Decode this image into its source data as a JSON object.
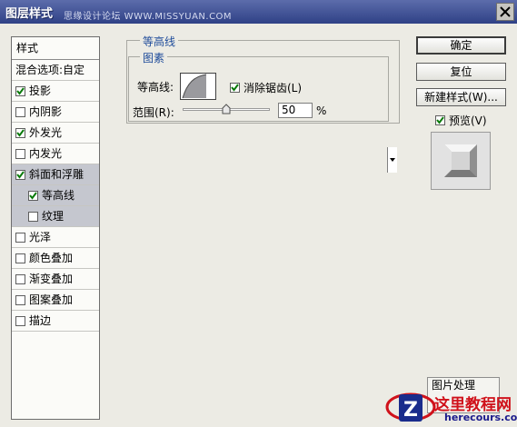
{
  "window": {
    "title": "图层样式",
    "watermark": "思缘设计论坛  WWW.MISSYUAN.COM",
    "close_glyph": "✕"
  },
  "style_list": {
    "header": "样式",
    "items": [
      {
        "label": "混合选项:自定",
        "checkbox": false,
        "checked": false,
        "indent": false,
        "selected": false
      },
      {
        "label": "投影",
        "checkbox": true,
        "checked": true,
        "indent": false,
        "selected": false
      },
      {
        "label": "内阴影",
        "checkbox": true,
        "checked": false,
        "indent": false,
        "selected": false
      },
      {
        "label": "外发光",
        "checkbox": true,
        "checked": true,
        "indent": false,
        "selected": false
      },
      {
        "label": "内发光",
        "checkbox": true,
        "checked": false,
        "indent": false,
        "selected": false
      },
      {
        "label": "斜面和浮雕",
        "checkbox": true,
        "checked": true,
        "indent": false,
        "selected": true
      },
      {
        "label": "等高线",
        "checkbox": true,
        "checked": true,
        "indent": true,
        "selected": true
      },
      {
        "label": "纹理",
        "checkbox": true,
        "checked": false,
        "indent": true,
        "selected": true
      },
      {
        "label": "光泽",
        "checkbox": true,
        "checked": false,
        "indent": false,
        "selected": false
      },
      {
        "label": "颜色叠加",
        "checkbox": true,
        "checked": false,
        "indent": false,
        "selected": false
      },
      {
        "label": "渐变叠加",
        "checkbox": true,
        "checked": false,
        "indent": false,
        "selected": false
      },
      {
        "label": "图案叠加",
        "checkbox": true,
        "checked": false,
        "indent": false,
        "selected": false
      },
      {
        "label": "描边",
        "checkbox": true,
        "checked": false,
        "indent": false,
        "selected": false
      }
    ]
  },
  "contour_panel": {
    "group_title": "等高线",
    "subgroup_title": "图素",
    "contour_label": "等高线:",
    "antialias_label": "消除锯齿(L)",
    "antialias_checked": true,
    "range_label": "范围(R):",
    "range_value": "50",
    "range_unit": "%",
    "range_fraction": 0.5
  },
  "buttons": {
    "ok": "确定",
    "reset": "复位",
    "new_style": "新建样式(W)...",
    "preview_label": "预览(V)",
    "preview_checked": true
  },
  "bottom_label": "图片处理",
  "logo": {
    "text": "这里教程网",
    "url": "herecours.com"
  },
  "colors": {
    "title_bar": "#2f4186",
    "legend_text": "#1e4b9a",
    "selected_row": "#c5c7cf",
    "logo_red": "#d0121b"
  }
}
